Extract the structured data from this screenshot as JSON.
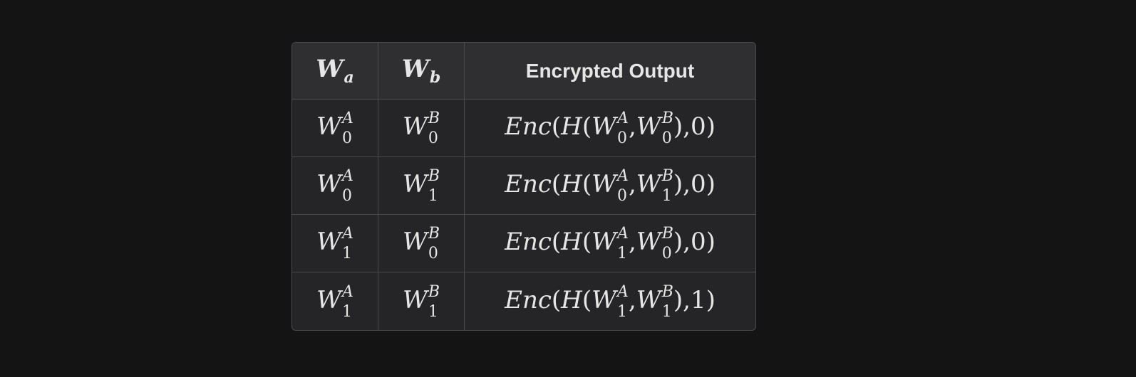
{
  "table": {
    "headers": [
      {
        "base": "W",
        "sub": "a"
      },
      {
        "base": "W",
        "sub": "b"
      },
      {
        "label": "Encrypted Output"
      }
    ],
    "rows": [
      {
        "wa": {
          "base": "W",
          "sup": "A",
          "sub": "0"
        },
        "wb": {
          "base": "W",
          "sup": "B",
          "sub": "0"
        },
        "out": {
          "fn": "Enc",
          "h": "H",
          "a_sub": "0",
          "b_sub": "0",
          "bit": "0"
        }
      },
      {
        "wa": {
          "base": "W",
          "sup": "A",
          "sub": "0"
        },
        "wb": {
          "base": "W",
          "sup": "B",
          "sub": "1"
        },
        "out": {
          "fn": "Enc",
          "h": "H",
          "a_sub": "0",
          "b_sub": "1",
          "bit": "0"
        }
      },
      {
        "wa": {
          "base": "W",
          "sup": "A",
          "sub": "1"
        },
        "wb": {
          "base": "W",
          "sup": "B",
          "sub": "0"
        },
        "out": {
          "fn": "Enc",
          "h": "H",
          "a_sub": "1",
          "b_sub": "0",
          "bit": "0"
        }
      },
      {
        "wa": {
          "base": "W",
          "sup": "A",
          "sub": "1"
        },
        "wb": {
          "base": "W",
          "sup": "B",
          "sub": "1"
        },
        "out": {
          "fn": "Enc",
          "h": "H",
          "a_sub": "1",
          "b_sub": "1",
          "bit": "1"
        }
      }
    ],
    "out_sup_a": "A",
    "out_sup_b": "B"
  },
  "colors": {
    "background": "#141414",
    "table_body": "#252527",
    "table_header": "#2f2f32",
    "border": "#4a4a4d",
    "text": "#e6e6e6"
  }
}
